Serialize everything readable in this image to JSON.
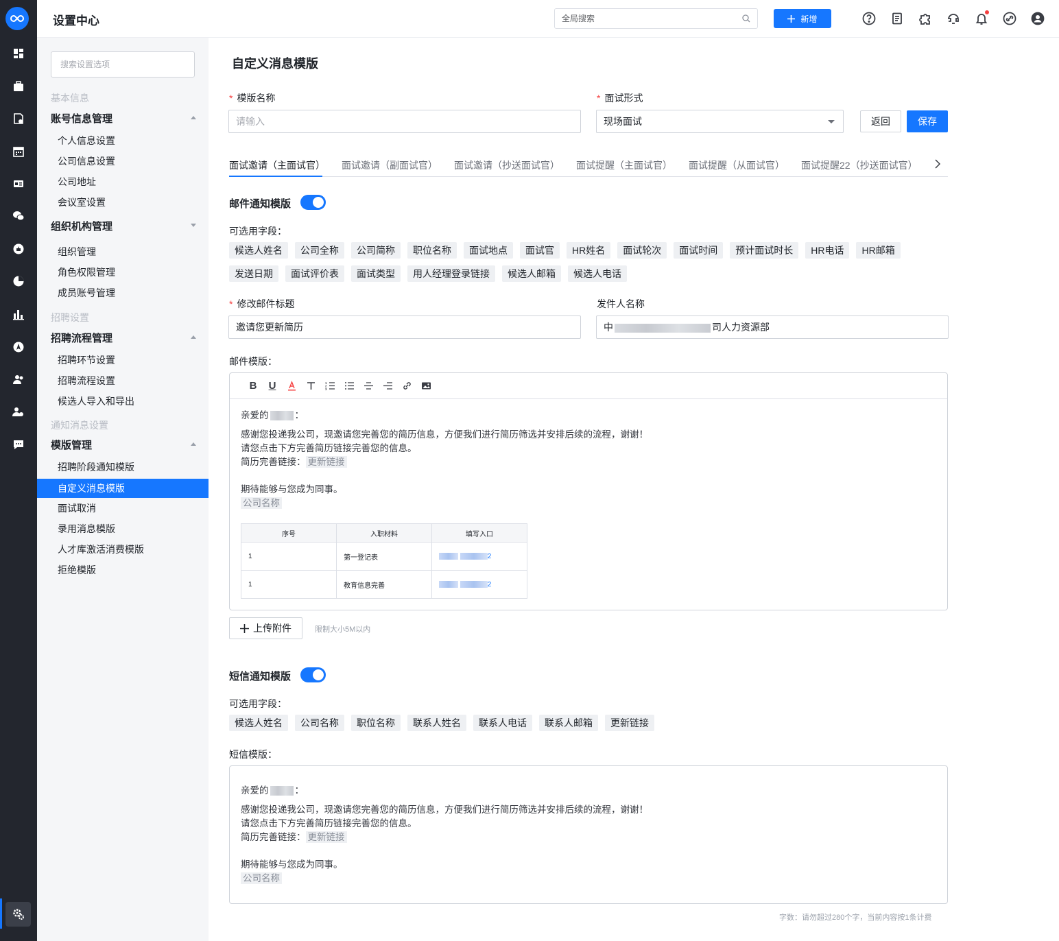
{
  "app": {
    "title": "设置中心",
    "global_search_placeholder": "全局搜索",
    "new_button": "新增"
  },
  "header_icons": [
    "help-icon",
    "document-icon",
    "plugin-icon",
    "support-icon",
    "bell-icon",
    "link-icon",
    "user-icon"
  ],
  "rail_icons": [
    "dashboard-icon",
    "briefcase-icon",
    "resume-icon",
    "calendar-icon",
    "id-card-icon",
    "wechat-icon",
    "thumbs-up-icon",
    "pie-chart-icon",
    "bar-chart-icon",
    "compass-icon",
    "people-icon",
    "team-icon",
    "chat-icon",
    "settings-icon"
  ],
  "sidebar": {
    "search_placeholder": "搜索设置选项",
    "group1": "基本信息",
    "menu1": "账号信息管理",
    "menu1_items": [
      "个人信息设置",
      "公司信息设置",
      "公司地址",
      "会议室设置"
    ],
    "menu2": "组织机构管理",
    "menu2_items": [
      "组织管理",
      "角色权限管理",
      "成员账号管理"
    ],
    "group2": "招聘设置",
    "menu3": "招聘流程管理",
    "menu3_items": [
      "招聘环节设置",
      "招聘流程设置",
      "候选人导入和导出"
    ],
    "group3": "通知消息设置",
    "menu4": "模版管理",
    "menu4_items": [
      "招聘阶段通知模版",
      "自定义消息模版",
      "面试取消",
      "录用消息模版",
      "人才库激活消费模版",
      "拒绝模版"
    ],
    "active_item": "自定义消息模版"
  },
  "page": {
    "title": "自定义消息模版",
    "template_name_label": "模版名称",
    "template_name_placeholder": "请输入",
    "interview_form_label": "面试形式",
    "interview_form_value": "现场面试",
    "back_button": "返回",
    "save_button": "保存",
    "tabs": [
      "面试邀请（主面试官）",
      "面试邀请（副面试官）",
      "面试邀请（抄送面试官）",
      "面试提醒（主面试官）",
      "面试提醒（从面试官）",
      "面试提醒22（抄送面试官）"
    ],
    "active_tab": 0
  },
  "email": {
    "section_title": "邮件通知模版",
    "enabled": true,
    "fields_label": "可选用字段：",
    "fields": [
      "候选人姓名",
      "公司全称",
      "公司简称",
      "职位名称",
      "面试地点",
      "面试官",
      "HR姓名",
      "面试轮次",
      "面试时间",
      "预计面试时长",
      "HR电话",
      "HR邮箱",
      "发送日期",
      "面试评价表",
      "面试类型",
      "用人经理登录链接",
      "候选人邮箱",
      "候选人电话"
    ],
    "subject_label": "修改邮件标题",
    "subject_value": "邀请您更新简历",
    "sender_label": "发件人名称",
    "sender_prefix": "中",
    "sender_suffix": "司人力资源部",
    "template_label": "邮件模版：",
    "toolbar": [
      "bold-icon",
      "underline-icon",
      "font-color-icon",
      "text-size-icon",
      "ordered-list-icon",
      "unordered-list-icon",
      "align-center-icon",
      "align-right-icon",
      "link-icon",
      "image-icon"
    ],
    "greeting_prefix": "亲爱的",
    "greeting_suffix": "：",
    "line1": "感谢您投递我公司，现邀请您完善您的简历信息，方便我们进行简历筛选并安排后续的流程，谢谢！",
    "line2": "请您点击下方完善简历链接完善您的信息。",
    "line3_prefix": "简历完善链接：",
    "link_tag": "更新链接",
    "line4": "期待能够与您成为同事。",
    "company_tag": "公司名称",
    "table_headers": [
      "序号",
      "入职材料",
      "填写入口"
    ],
    "table_rows": [
      {
        "no": "1",
        "material": "第一登记表",
        "link_tail": "2"
      },
      {
        "no": "1",
        "material": "教育信息完善",
        "link_tail": "2"
      }
    ],
    "upload_button": "上传附件",
    "upload_hint": "限制大小5M以内"
  },
  "sms": {
    "section_title": "短信通知模版",
    "enabled": true,
    "fields_label": "可选用字段：",
    "fields": [
      "候选人姓名",
      "公司名称",
      "职位名称",
      "联系人姓名",
      "联系人电话",
      "联系人邮箱",
      "更新链接"
    ],
    "template_label": "短信模版：",
    "greeting_prefix": "亲爱的",
    "greeting_suffix": "：",
    "line1": "感谢您投递我公司，现邀请您完善您的简历信息，方便我们进行简历筛选并安排后续的流程，谢谢！",
    "line2": "请您点击下方完善简历链接完善您的信息。",
    "line3_prefix": "简历完善链接：",
    "link_tag": "更新链接",
    "line4": "期待能够与您成为同事。",
    "company_tag": "公司名称",
    "count_hint": "字数：请勿超过280个字，当前内容按1条计费"
  },
  "colors": {
    "primary": "#1677ff",
    "rail": "#23262e",
    "sidebar_bg": "#f5f6f8",
    "required": "#f53f3f"
  }
}
